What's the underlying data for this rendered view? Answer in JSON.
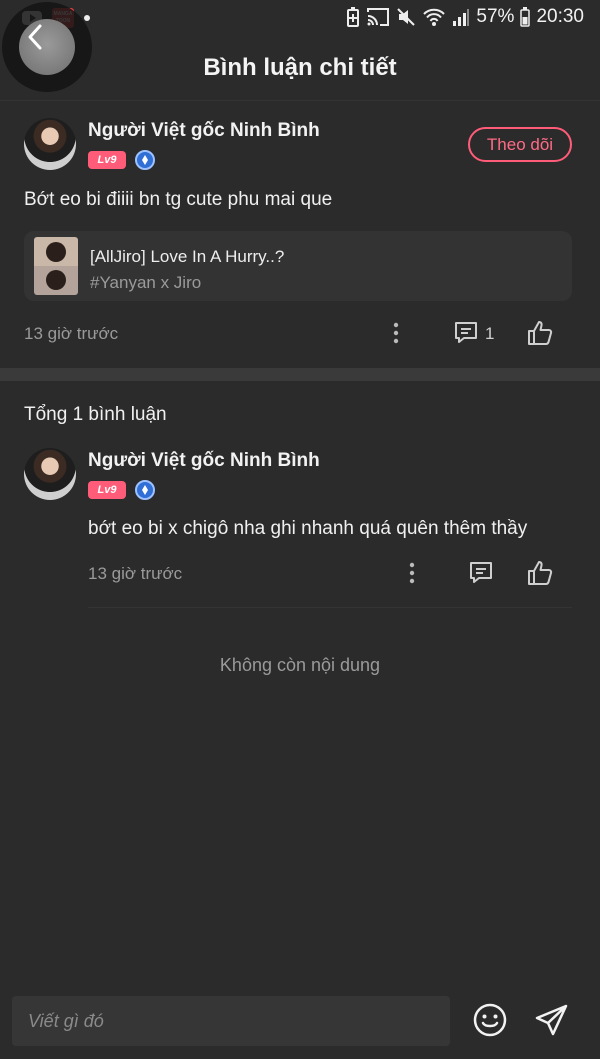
{
  "status_bar": {
    "battery": "57%",
    "time": "20:30",
    "icons": [
      "youtube-icon",
      "mangatoon-icon",
      "dot-icon",
      "battery-saver-icon",
      "cast-icon",
      "mute-icon",
      "wifi-icon",
      "signal-icon"
    ]
  },
  "header": {
    "title": "Bình luận chi tiết",
    "back_icon": "chevron-left-icon"
  },
  "post": {
    "username": "Người Việt gốc Ninh Bình",
    "level": "Lv9",
    "follow_label": "Theo dõi",
    "text": "Bớt eo bi điiii bn tg cute phu mai que",
    "book": {
      "title": "[AllJiro] Love In A Hurry..?",
      "tag": "#Yanyan x Jiro"
    },
    "time": "13 giờ trước",
    "comment_count": "1"
  },
  "comments_section": {
    "total_label": "Tổng 1 bình luận",
    "comments": [
      {
        "username": "Người Việt gốc Ninh Bình",
        "level": "Lv9",
        "text": "bớt eo bi x chigô nha ghi nhanh quá quên thêm thầy",
        "time": "13 giờ trước"
      }
    ],
    "no_more_label": "Không còn nội dung"
  },
  "composer": {
    "placeholder": "Viết gì đó"
  },
  "colors": {
    "background": "#2b2b2b",
    "accent_pink": "#ff5c7a",
    "muted_text": "#9a9a9a"
  }
}
